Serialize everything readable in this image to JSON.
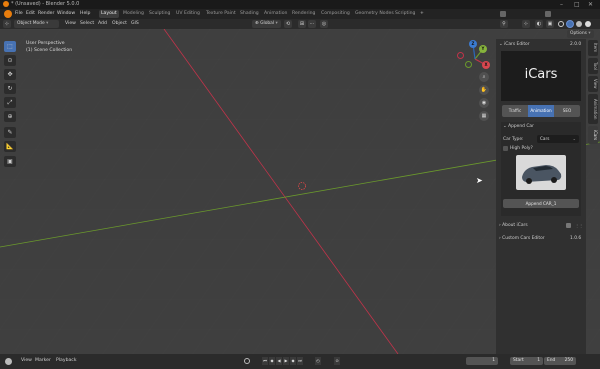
{
  "window": {
    "title": "* (Unsaved) - Blender 5.0.0"
  },
  "menu": [
    "File",
    "Edit",
    "Render",
    "Window",
    "Help"
  ],
  "workspaces": [
    "Layout",
    "Modeling",
    "Sculpting",
    "UV Editing",
    "Texture Paint",
    "Shading",
    "Animation",
    "Rendering",
    "Compositing",
    "Geometry Nodes",
    "Scripting"
  ],
  "active_workspace": "Layout",
  "header": {
    "mode": "Object Mode",
    "menus": [
      "View",
      "Select",
      "Add",
      "Object",
      "GIS"
    ],
    "orientation": "Global",
    "options_label": "Options"
  },
  "viewport": {
    "perspective": "User Perspective",
    "collection": "(1) Scene Collection",
    "gizmo_axes": [
      "X",
      "Y",
      "Z"
    ],
    "x_axis_color": "#c2334a",
    "y_axis_color": "#6b9a2c",
    "background_color": "#3f3f3f"
  },
  "npanel": {
    "icars_header": "iCars Editor",
    "icars_version": "2.0.0",
    "logo_text": "iCars",
    "tabs": [
      "Traffic",
      "Animation",
      "SEO"
    ],
    "active_tab": "Animation",
    "append_car_header": "Append Car",
    "car_type_label": "Car Type:",
    "car_type_value": "Cars",
    "high_poly_label": "High Poly?",
    "append_button": "Append CAR_1",
    "about_label": "About iCars",
    "custom_label": "Custom Cars Editor",
    "custom_version": "1.0.6",
    "accent_color": "#4772b3",
    "side_tabs": [
      "Item",
      "Tool",
      "View",
      "Animation",
      "iCars"
    ]
  },
  "timeline": {
    "menus": [
      "View",
      "Marker",
      "Playback"
    ],
    "current_frame": "1",
    "start_label": "Start",
    "start_value": "1",
    "end_label": "End",
    "end_value": "250"
  }
}
